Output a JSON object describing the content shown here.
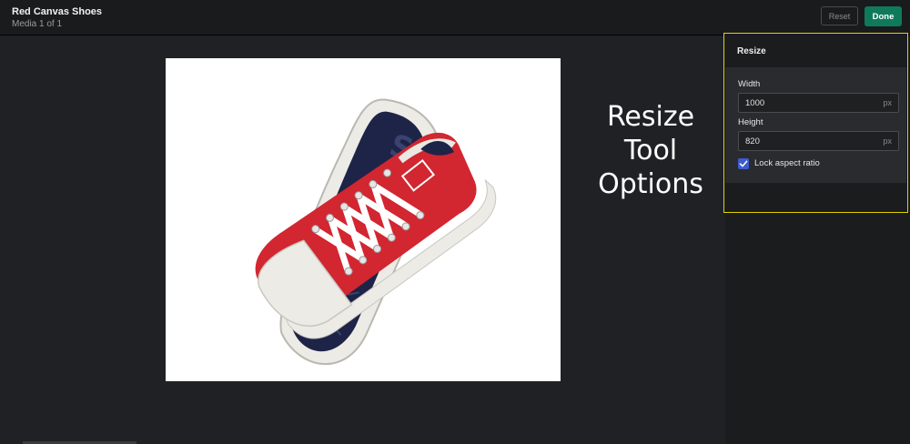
{
  "header": {
    "title": "Red Canvas Shoes",
    "subtitle": "Media 1 of 1",
    "reset_label": "Reset",
    "done_label": "Done"
  },
  "canvas": {
    "image_alt": "Red canvas sneakers product photo"
  },
  "annotation": {
    "line1": "Resize",
    "line2": "Tool",
    "line3": "Options"
  },
  "resize_panel": {
    "title": "Resize",
    "width_label": "Width",
    "width_value": "1000",
    "width_unit": "px",
    "height_label": "Height",
    "height_value": "820",
    "height_unit": "px",
    "lock_label": "Lock aspect ratio",
    "lock_checked": true
  },
  "colors": {
    "accent_done": "#0f7a5a",
    "highlight_border": "#e0d100",
    "checkbox": "#3c5ccf",
    "shoe_red": "#d22630",
    "sole_navy": "#1e2447"
  }
}
